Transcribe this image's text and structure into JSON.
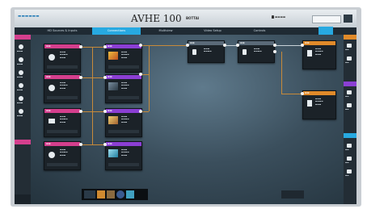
{
  "app": {
    "title": "AVHE 100",
    "subtitle": "BOTTAl"
  },
  "tabs": [
    {
      "label": "HD Sources & Inputs",
      "active": false
    },
    {
      "label": "Connections",
      "active": true
    },
    {
      "label": "Multiview",
      "active": false
    },
    {
      "label": "Video Setup",
      "active": false
    },
    {
      "label": "Controls",
      "active": false
    }
  ],
  "colors": {
    "accent": "#27a9e1",
    "wire": "#c78a3a",
    "source_header": "#d43f8d",
    "processor_header": "#8b3fd4",
    "output_header": "#e08a2a"
  }
}
